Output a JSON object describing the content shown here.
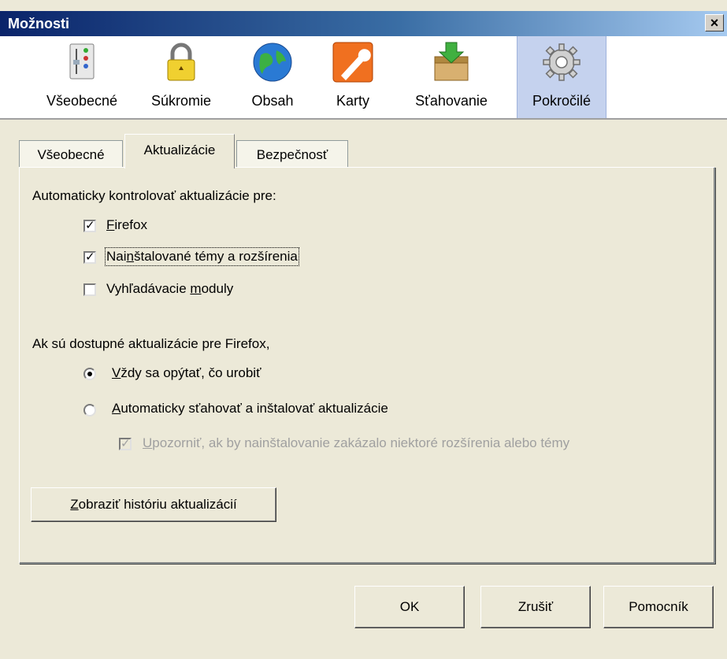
{
  "window": {
    "title": "Možnosti",
    "close": "×"
  },
  "toolbar": {
    "items": [
      {
        "label": "Všeobecné",
        "icon": "general-sliders-icon"
      },
      {
        "label": "Súkromie",
        "icon": "padlock-icon"
      },
      {
        "label": "Obsah",
        "icon": "globe-icon"
      },
      {
        "label": "Karty",
        "icon": "wrench-icon"
      },
      {
        "label": "Sťahovanie",
        "icon": "download-box-icon"
      },
      {
        "label": "Pokročilé",
        "icon": "gear-icon",
        "selected": true
      }
    ]
  },
  "tabs": [
    {
      "label": "Všeobecné"
    },
    {
      "label": "Aktualizácie",
      "active": true
    },
    {
      "label": "Bezpečnosť"
    }
  ],
  "updates": {
    "check_heading": "Automaticky kontrolovať aktualizácie pre:",
    "checkboxes": [
      {
        "pre": "",
        "accel": "F",
        "post": "irefox",
        "checked": true
      },
      {
        "pre": "Nai",
        "accel": "n",
        "post": "štalované témy a rozšírenia",
        "checked": true
      },
      {
        "pre": "Vyhľadávacie ",
        "accel": "m",
        "post": "oduly",
        "checked": false
      }
    ],
    "available_heading": "Ak sú dostupné aktualizácie pre Firefox,",
    "radios": [
      {
        "pre": "",
        "accel": "V",
        "post": "ždy sa opýtať, čo urobiť",
        "selected": true
      },
      {
        "pre": "",
        "accel": "A",
        "post": "utomaticky sťahovať a inštalovať aktualizácie",
        "selected": false
      }
    ],
    "warn_checkbox": {
      "pre": "",
      "accel": "U",
      "post": "pozorniť, ak by nainštalovanie zakázalo niektoré rozšírenia alebo témy",
      "checked": true,
      "disabled": true
    },
    "history_button": {
      "pre": "",
      "accel": "Z",
      "post": "obraziť históriu aktualizácií"
    }
  },
  "footer": {
    "ok": "OK",
    "cancel": "Zrušiť",
    "help": "Pomocník"
  },
  "colors": {
    "accent": "#0a246a",
    "selected_tab_bg": "#c5d2ee",
    "dialog_bg": "#ece9d8"
  }
}
